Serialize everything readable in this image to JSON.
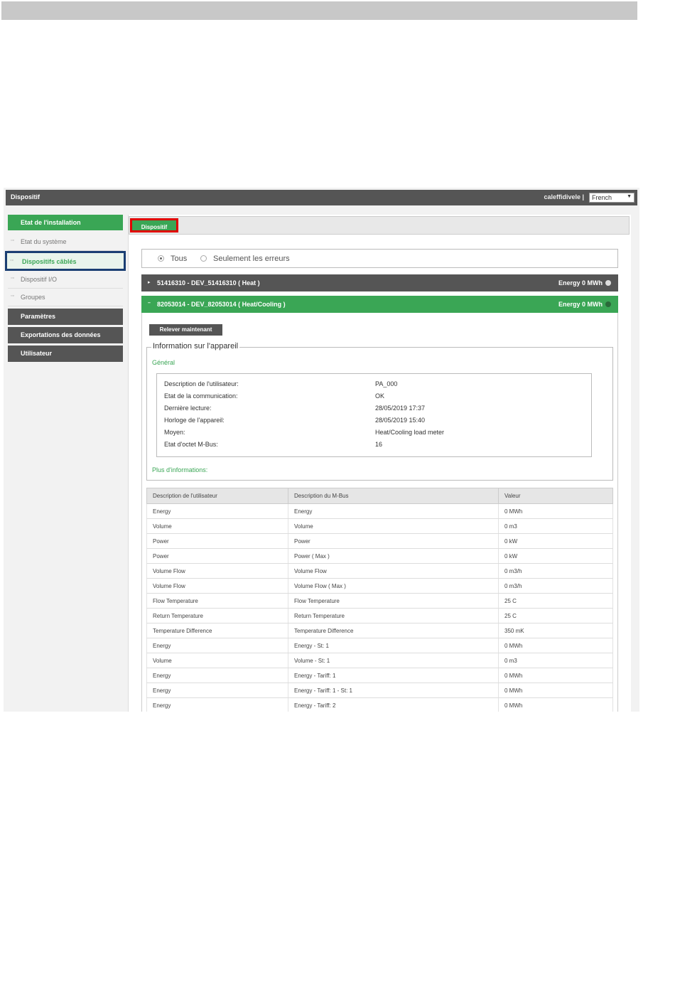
{
  "app": {
    "title": "Dispositif",
    "user": "caleffidivele |",
    "language": "French"
  },
  "sidebar": {
    "primary": "Etat de l'installation",
    "items": [
      {
        "label": "Etat du système"
      },
      {
        "label": "Dispositifs câblés"
      },
      {
        "label": "Dispositif I/O"
      },
      {
        "label": "Groupes"
      }
    ],
    "sections": [
      {
        "label": "Paramètres"
      },
      {
        "label": "Exportations des données"
      },
      {
        "label": "Utilisateur"
      }
    ]
  },
  "tab": {
    "label": "Dispositif"
  },
  "filter": {
    "all": "Tous",
    "errors_only": "Seulement les erreurs"
  },
  "devices": [
    {
      "name": "51416310 - DEV_51416310 ( Heat )",
      "energy": "Energy 0 MWh"
    },
    {
      "name": "82053014 - DEV_82053014 ( Heat/Cooling )",
      "energy": "Energy 0 MWh"
    }
  ],
  "panel": {
    "read_button": "Relever maintenant",
    "info_title": "Information sur l'appareil",
    "general": "Général",
    "more": "Plus d'informations:",
    "info": [
      {
        "k": "Description de l'utilisateur:",
        "v": "PA_000"
      },
      {
        "k": "Etat de la communication:",
        "v": "OK"
      },
      {
        "k": "Dernière lecture:",
        "v": "28/05/2019 17:37"
      },
      {
        "k": "Horloge de l'appareil:",
        "v": "28/05/2019 15:40"
      },
      {
        "k": "Moyen:",
        "v": "Heat/Cooling load meter"
      },
      {
        "k": "Etat d'octet M-Bus:",
        "v": "16"
      }
    ]
  },
  "table": {
    "headers": [
      "Description de l'utilisateur",
      "Description du M-Bus",
      "Valeur"
    ],
    "rows": [
      [
        "Energy",
        "Energy",
        "0 MWh"
      ],
      [
        "Volume",
        "Volume",
        "0 m3"
      ],
      [
        "Power",
        "Power",
        "0 kW"
      ],
      [
        "Power",
        "Power ( Max )",
        "0 kW"
      ],
      [
        "Volume Flow",
        "Volume Flow",
        "0 m3/h"
      ],
      [
        "Volume Flow",
        "Volume Flow ( Max )",
        "0 m3/h"
      ],
      [
        "Flow Temperature",
        "Flow Temperature",
        "25 C"
      ],
      [
        "Return Temperature",
        "Return Temperature",
        "25 C"
      ],
      [
        "Temperature Difference",
        "Temperature Difference",
        "350 mK"
      ],
      [
        "Energy",
        "Energy - St: 1",
        "0 MWh"
      ],
      [
        "Volume",
        "Volume - St: 1",
        "0 m3"
      ],
      [
        "Energy",
        "Energy - Tariff: 1",
        "0 MWh"
      ],
      [
        "Energy",
        "Energy - Tariff: 1 - St: 1",
        "0 MWh"
      ],
      [
        "Energy",
        "Energy - Tariff: 2",
        "0 MWh"
      ]
    ]
  }
}
